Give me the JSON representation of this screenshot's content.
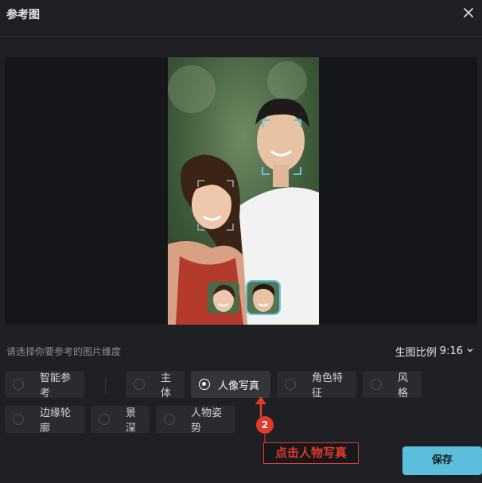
{
  "dialog": {
    "title": "参考图"
  },
  "hint": "请选择你要参考的图片维度",
  "ratio": {
    "label": "生图比例",
    "value": "9:16"
  },
  "options": {
    "smart_ref": "智能参考",
    "subject": "主体",
    "portrait": "人像写真",
    "character": "角色特征",
    "style": "风格",
    "edge": "边缘轮廓",
    "depth": "景深",
    "pose": "人物姿势"
  },
  "selected_option": "人像写真",
  "annotation": {
    "step": "2",
    "text": "点击人物写真"
  },
  "buttons": {
    "save": "保存"
  },
  "colors": {
    "accent": "#5bbfdc",
    "annotation": "#e33a2c",
    "background": "#1f2024"
  }
}
